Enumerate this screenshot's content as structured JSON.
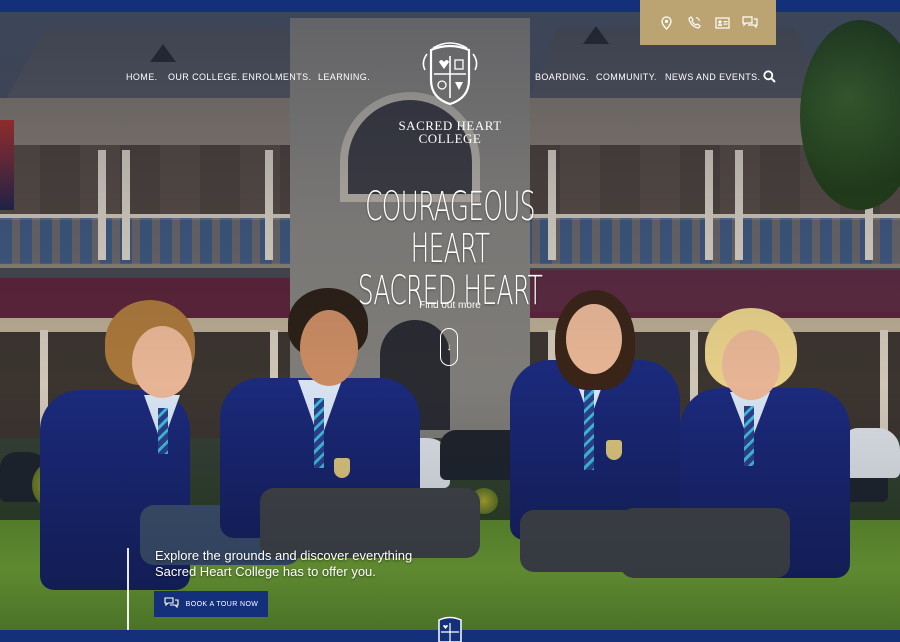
{
  "utility": {
    "icons": [
      "location-pin-icon",
      "phone-icon",
      "contact-card-icon",
      "chat-icon"
    ]
  },
  "nav": {
    "left": [
      "HOME.",
      "OUR COLLEGE.",
      "ENROLMENTS.",
      "LEARNING."
    ],
    "right": [
      "BOARDING.",
      "COMMUNITY.",
      "NEWS AND EVENTS."
    ]
  },
  "logo": {
    "line1": "Sacred Heart",
    "line2": "College"
  },
  "hero": {
    "headline_line1": "Courageous Heart",
    "headline_line2": "Sacred Heart",
    "find_out_more": "Find out more"
  },
  "tour": {
    "text": "Explore the grounds and discover everything Sacred Heart College has to offer you.",
    "button_label": "BOOK A TOUR NOW"
  },
  "colors": {
    "navy": "#14307a",
    "gold": "#bba472",
    "white": "#ffffff"
  }
}
